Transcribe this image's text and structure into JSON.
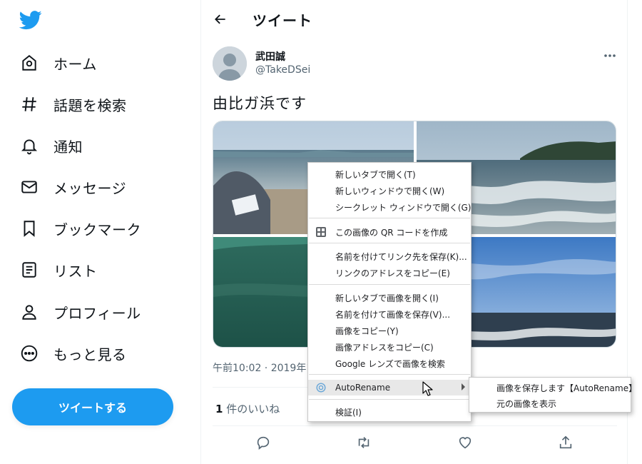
{
  "sidebar": {
    "logo": "twitter-bird-icon",
    "items": [
      {
        "label": "ホーム",
        "icon": "home-icon"
      },
      {
        "label": "話題を検索",
        "icon": "hashtag-icon"
      },
      {
        "label": "通知",
        "icon": "bell-icon"
      },
      {
        "label": "メッセージ",
        "icon": "mail-icon"
      },
      {
        "label": "ブックマーク",
        "icon": "bookmark-icon"
      },
      {
        "label": "リスト",
        "icon": "list-icon"
      },
      {
        "label": "プロフィール",
        "icon": "person-icon"
      },
      {
        "label": "もっと見る",
        "icon": "more-circle-icon"
      }
    ],
    "tweet_button": "ツイートする"
  },
  "header": {
    "title": "ツイート"
  },
  "tweet": {
    "user_name": "武田誠",
    "handle": "@TakeDSei",
    "text": "由比ガ浜です",
    "meta": "午前10:02 · 2019年10",
    "likes_count": "1",
    "likes_label": " 件のいいね"
  },
  "context_menu": {
    "groups": [
      [
        "新しいタブで開く(T)",
        "新しいウィンドウで開く(W)",
        "シークレット ウィンドウで開く(G)"
      ],
      [
        "この画像の QR コードを作成"
      ],
      [
        "名前を付けてリンク先を保存(K)...",
        "リンクのアドレスをコピー(E)"
      ],
      [
        "新しいタブで画像を開く(I)",
        "名前を付けて画像を保存(V)...",
        "画像をコピー(Y)",
        "画像アドレスをコピー(C)",
        "Google レンズで画像を検索"
      ],
      [
        "AutoRename"
      ],
      [
        "検証(I)"
      ]
    ],
    "submenu": [
      "画像を保存します【AutoRename】",
      "元の画像を表示"
    ]
  },
  "colors": {
    "accent": "#1d9bf0",
    "text": "#0f1419",
    "muted": "#536471",
    "menu_highlight": "#e8e8e8"
  }
}
